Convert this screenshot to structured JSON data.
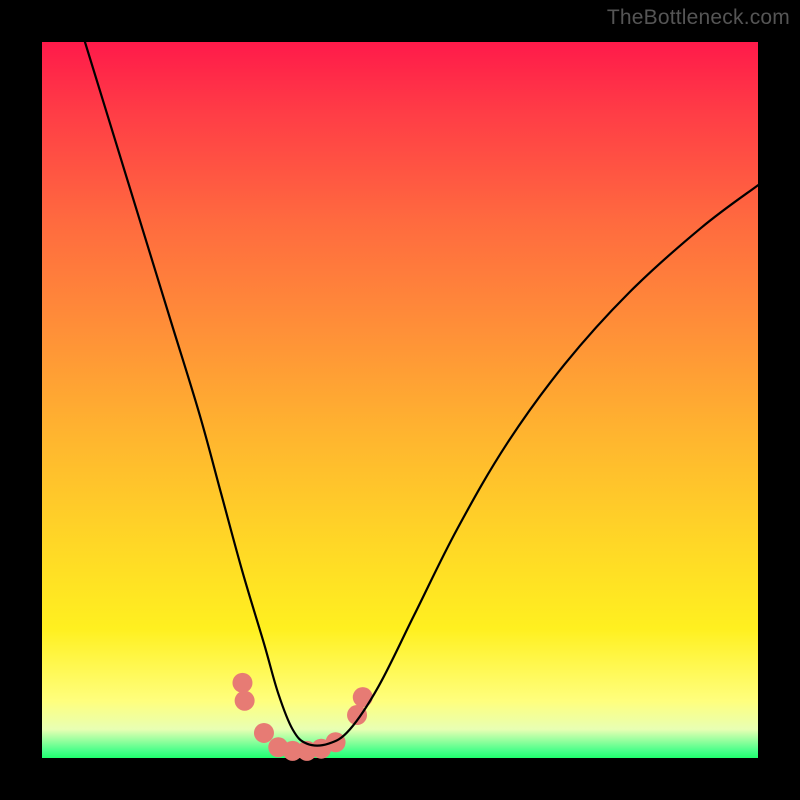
{
  "watermark": "TheBottleneck.com",
  "chart_data": {
    "type": "line",
    "title": "",
    "xlabel": "",
    "ylabel": "",
    "xlim": [
      0,
      100
    ],
    "ylim": [
      0,
      100
    ],
    "background_gradient_stops": [
      {
        "pos": 0,
        "color": "#ff1a4a"
      },
      {
        "pos": 25,
        "color": "#ff6a3f"
      },
      {
        "pos": 55,
        "color": "#ffb52f"
      },
      {
        "pos": 82,
        "color": "#fff020"
      },
      {
        "pos": 96,
        "color": "#e8ffb3"
      },
      {
        "pos": 100,
        "color": "#1fff6e"
      }
    ],
    "series": [
      {
        "name": "bottleneck-curve",
        "color": "#000000",
        "x": [
          6,
          10,
          14,
          18,
          22,
          25,
          28,
          31,
          33,
          35,
          37,
          40,
          43,
          47,
          52,
          58,
          65,
          73,
          82,
          92,
          100
        ],
        "values": [
          100,
          87,
          74,
          61,
          48,
          37,
          26,
          16,
          9,
          4,
          2,
          2,
          4,
          10,
          20,
          32,
          44,
          55,
          65,
          74,
          80
        ]
      }
    ],
    "markers": {
      "name": "highlight-dots",
      "color": "#e77b74",
      "radius": 10,
      "points": [
        {
          "x": 28.0,
          "y": 10.5
        },
        {
          "x": 28.3,
          "y": 8.0
        },
        {
          "x": 31.0,
          "y": 3.5
        },
        {
          "x": 33.0,
          "y": 1.5
        },
        {
          "x": 35.0,
          "y": 1.0
        },
        {
          "x": 37.0,
          "y": 1.0
        },
        {
          "x": 39.0,
          "y": 1.3
        },
        {
          "x": 41.0,
          "y": 2.2
        },
        {
          "x": 44.0,
          "y": 6.0
        },
        {
          "x": 44.8,
          "y": 8.5
        }
      ]
    }
  }
}
